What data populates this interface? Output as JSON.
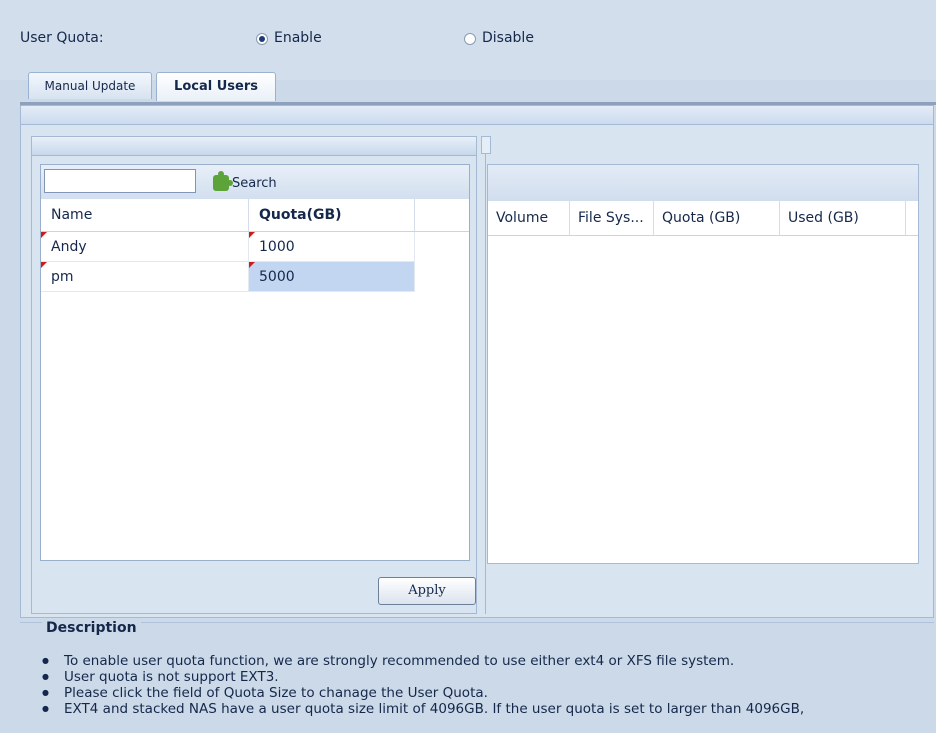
{
  "user_quota": {
    "label": "User Quota:",
    "enable_label": "Enable",
    "disable_label": "Disable",
    "selected": "enable"
  },
  "tabs": [
    {
      "label": "Manual Update",
      "active": false
    },
    {
      "label": "Local Users",
      "active": true
    }
  ],
  "search": {
    "value": "",
    "placeholder": "",
    "button_label": "Search",
    "button_icon": "puzzle-icon"
  },
  "users_table": {
    "columns": [
      "Name",
      "Quota(GB)"
    ],
    "rows": [
      {
        "name": "Andy",
        "quota": "1000"
      },
      {
        "name": "pm",
        "quota": "5000"
      }
    ]
  },
  "apply_label": "Apply",
  "quota_table": {
    "columns": [
      "Volume",
      "File Sys...",
      "Quota (GB)",
      "Used (GB)"
    ]
  },
  "description": {
    "title": "Description",
    "items": [
      "To enable user quota function, we are strongly recommended to use either ext4 or XFS file system.",
      "User quota is not support EXT3.",
      "Please click the field of Quota Size to chanage the User Quota.",
      "EXT4 and stacked NAS have a user quota size limit of 4096GB. If the user quota is set to larger than 4096GB,"
    ]
  },
  "colors": {
    "background": "#ccd9e8",
    "selection": "#c3d6f1",
    "dirty_marker": "#cc1c1c"
  }
}
